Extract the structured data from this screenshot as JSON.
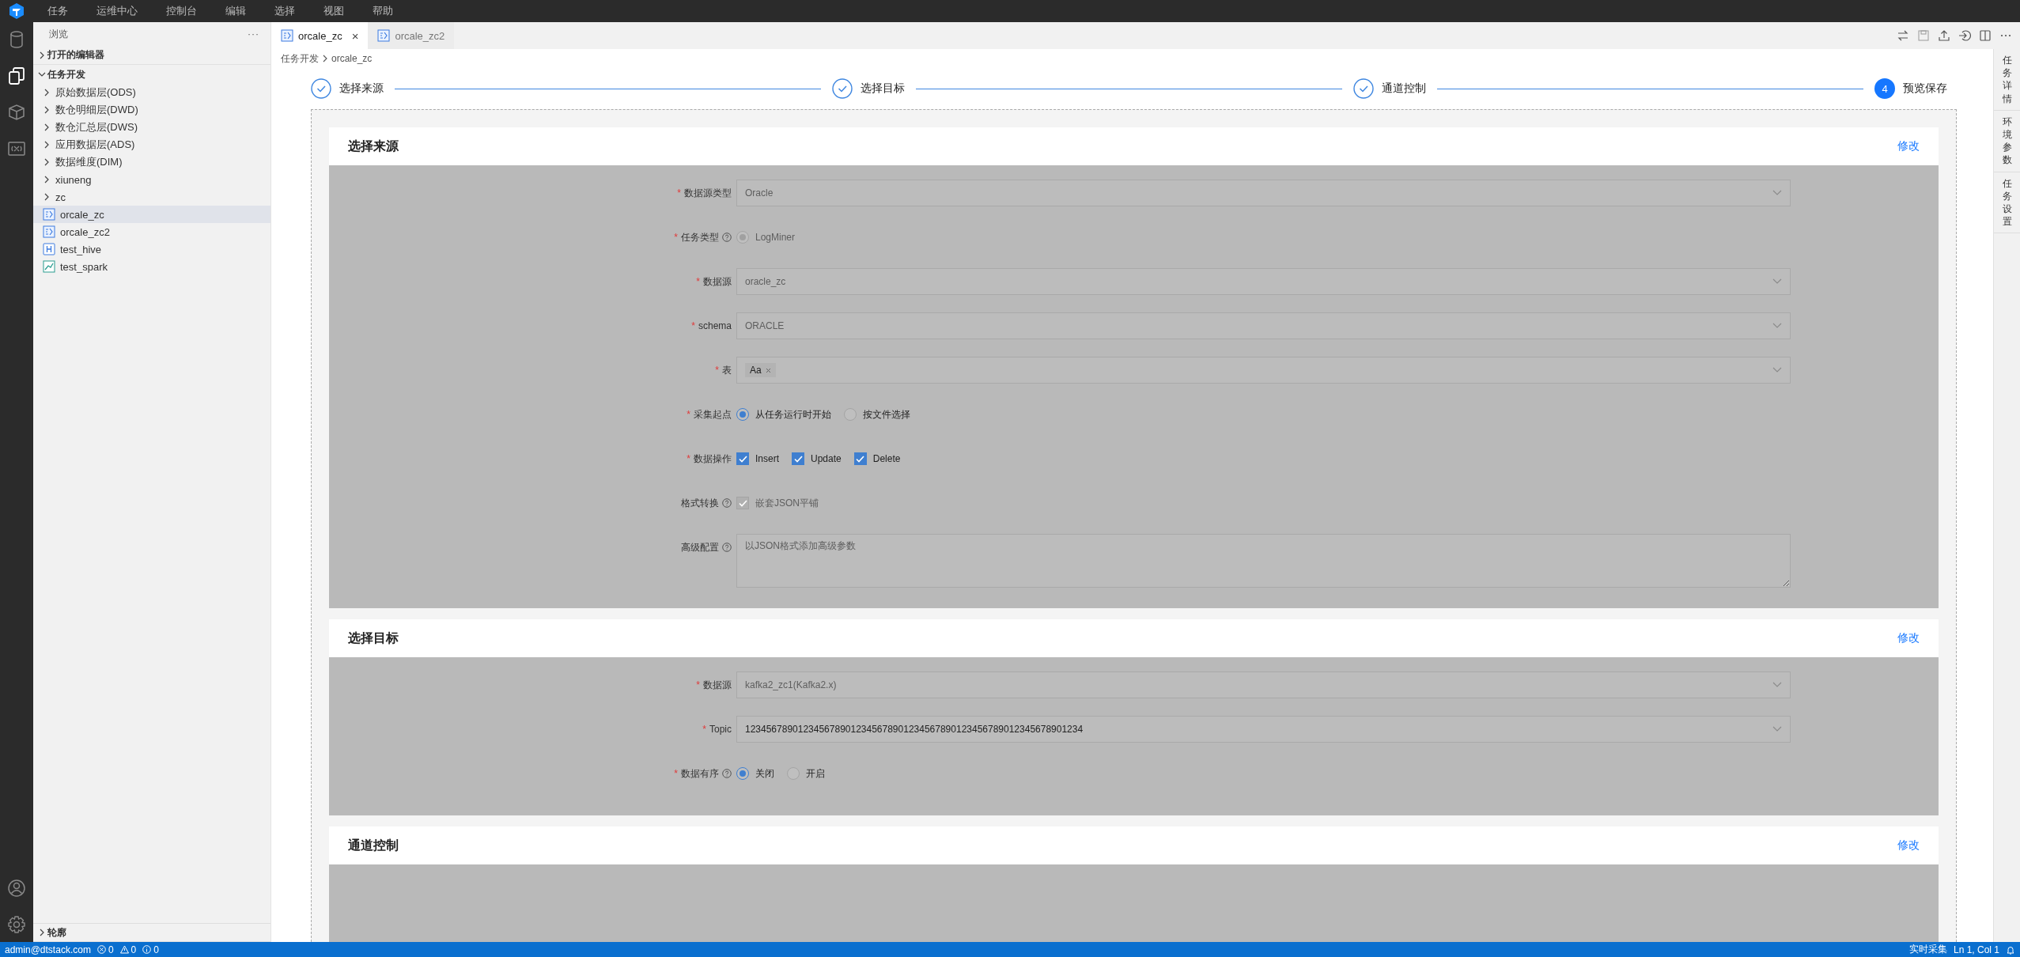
{
  "menu": [
    "任务",
    "运维中心",
    "控制台",
    "编辑",
    "选择",
    "视图",
    "帮助"
  ],
  "activity_bar": [
    {
      "kind": "database",
      "selected": false
    },
    {
      "kind": "files",
      "selected": true
    },
    {
      "kind": "cube",
      "selected": false
    },
    {
      "kind": "variable",
      "selected": false
    }
  ],
  "activity_bar_bottom": [
    {
      "kind": "account"
    },
    {
      "kind": "settings"
    }
  ],
  "explorer": {
    "title": "浏览",
    "more": "···",
    "sections": [
      {
        "label": "打开的编辑器",
        "expanded": false
      },
      {
        "label": "任务开发",
        "expanded": true,
        "items": [
          {
            "label": "原始数据层(ODS)",
            "kind": "folder",
            "selected": false
          },
          {
            "label": "数仓明细层(DWD)",
            "kind": "folder",
            "selected": false
          },
          {
            "label": "数仓汇总层(DWS)",
            "kind": "folder",
            "selected": false
          },
          {
            "label": "应用数据层(ADS)",
            "kind": "folder",
            "selected": false
          },
          {
            "label": "数据维度(DIM)",
            "kind": "folder",
            "selected": false
          },
          {
            "label": "xiuneng",
            "kind": "folder",
            "selected": false
          },
          {
            "label": "zc",
            "kind": "folder",
            "selected": false
          },
          {
            "label": "orcale_zc",
            "kind": "realtime",
            "selected": true
          },
          {
            "label": "orcale_zc2",
            "kind": "realtime",
            "selected": false
          },
          {
            "label": "test_hive",
            "kind": "hive",
            "selected": false
          },
          {
            "label": "test_spark",
            "kind": "spark",
            "selected": false
          }
        ]
      }
    ],
    "outline": {
      "label": "轮廓",
      "expanded": false
    }
  },
  "tabs": [
    {
      "label": "orcale_zc",
      "selected": true,
      "close": "×"
    },
    {
      "label": "orcale_zc2",
      "selected": false
    }
  ],
  "toolbar": [
    {
      "kind": "swap"
    },
    {
      "kind": "save"
    },
    {
      "kind": "upload"
    },
    {
      "kind": "exit"
    },
    {
      "kind": "split"
    },
    {
      "kind": "more"
    }
  ],
  "breadcrumb": [
    "任务开发",
    "orcale_zc"
  ],
  "steps": [
    {
      "label": "选择来源",
      "completed": true
    },
    {
      "label": "选择目标",
      "completed": true
    },
    {
      "label": "通道控制",
      "completed": true
    },
    {
      "label": "预览保存",
      "completed": false,
      "number": "4"
    }
  ],
  "side_tabs": [
    "任务详情",
    "环境参数",
    "任务设置"
  ],
  "sections": [
    {
      "title": "选择来源",
      "action": "修改",
      "fields": [
        {
          "label": "数据源类型",
          "marker": "*",
          "kind": "select",
          "value": "Oracle",
          "disabled": true
        },
        {
          "label": "任务类型",
          "marker": "*",
          "help": true,
          "kind": "radio",
          "disabled": true,
          "options": [
            {
              "label": "LogMiner",
              "selected": true
            }
          ]
        },
        {
          "label": "数据源",
          "marker": "*",
          "kind": "select",
          "value": "oracle_zc",
          "disabled": true
        },
        {
          "label": "schema",
          "marker": "*",
          "kind": "select",
          "value": "ORACLE",
          "disabled": true
        },
        {
          "label": "表",
          "marker": "*",
          "kind": "tags",
          "tags": [
            "Aa"
          ],
          "disabled": false
        },
        {
          "label": "采集起点",
          "marker": "*",
          "kind": "radio",
          "disabled": false,
          "options": [
            {
              "label": "从任务运行时开始",
              "selected": true
            },
            {
              "label": "按文件选择",
              "selected": false
            }
          ]
        },
        {
          "label": "数据操作",
          "marker": "*",
          "kind": "checkbox",
          "disabled": false,
          "options": [
            {
              "label": "Insert",
              "checked": true
            },
            {
              "label": "Update",
              "checked": true
            },
            {
              "label": "Delete",
              "checked": true
            }
          ]
        },
        {
          "label": "格式转换",
          "help": true,
          "kind": "checkbox",
          "disabled": true,
          "options": [
            {
              "label": "嵌套JSON平铺",
              "checked": true
            }
          ]
        },
        {
          "label": "高级配置",
          "help": true,
          "kind": "textarea",
          "placeholder": "以JSON格式添加高级参数",
          "disabled": true
        }
      ]
    },
    {
      "title": "选择目标",
      "action": "修改",
      "fields": [
        {
          "label": "数据源",
          "marker": "*",
          "kind": "select",
          "value": "kafka2_zc1(Kafka2.x)",
          "disabled": true
        },
        {
          "label": "Topic",
          "marker": "*",
          "kind": "select",
          "value": "1234567890123456789012345678901234567890123456789012345678901234",
          "disabled": false
        },
        {
          "label": "数据有序",
          "marker": "*",
          "help": true,
          "kind": "radio",
          "disabled": false,
          "options": [
            {
              "label": "关闭",
              "selected": true
            },
            {
              "label": "开启",
              "selected": false
            }
          ]
        }
      ]
    },
    {
      "title": "通道控制",
      "action": "修改"
    }
  ],
  "status_bar": {
    "user": "admin@dtstack.com",
    "errors": "0",
    "warnings": "0",
    "infos": "0",
    "mode": "实时采集",
    "position": "Ln 1, Col 1"
  }
}
